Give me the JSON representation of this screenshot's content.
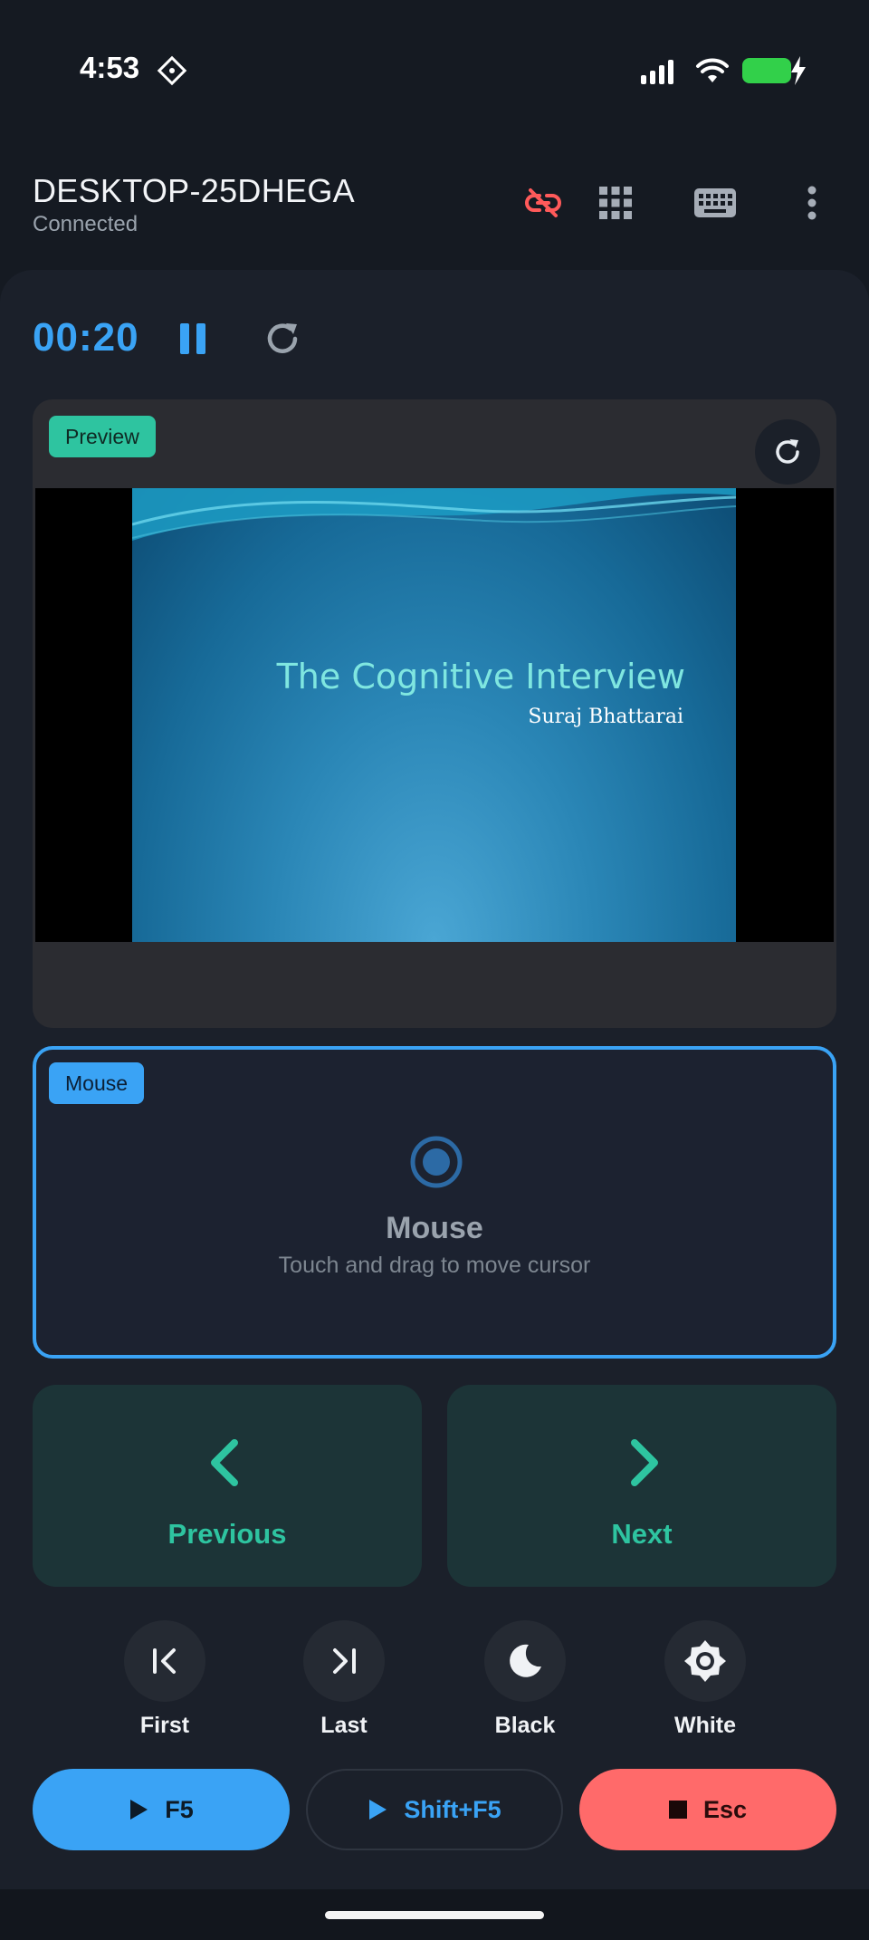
{
  "status_bar": {
    "time": "4:53",
    "icons": [
      "location-diamond-icon",
      "signal-icon",
      "wifi-icon",
      "battery-charging-icon"
    ]
  },
  "header": {
    "device_name": "DESKTOP-25DHEGA",
    "connection_status": "Connected",
    "icons": [
      "disconnect-link-icon",
      "grid-icon",
      "keyboard-icon",
      "more-vert-icon"
    ],
    "disconnect_color": "#ff5a5a"
  },
  "timer": {
    "elapsed": "00:20",
    "controls": [
      "pause-icon",
      "restart-icon"
    ]
  },
  "preview": {
    "badge": "Preview",
    "slide_title": "The Cognitive Interview",
    "slide_subtitle": "Suraj Bhattarai"
  },
  "mouse_pad": {
    "badge": "Mouse",
    "title": "Mouse",
    "hint": "Touch and drag to move cursor"
  },
  "navigation": {
    "previous_label": "Previous",
    "next_label": "Next"
  },
  "slide_controls": [
    {
      "label": "First",
      "icon": "first-slide-icon"
    },
    {
      "label": "Last",
      "icon": "last-slide-icon"
    },
    {
      "label": "Black",
      "icon": "moon-icon"
    },
    {
      "label": "White",
      "icon": "sun-icon"
    }
  ],
  "actions": {
    "start_label": "F5",
    "start_current_label": "Shift+F5",
    "end_label": "Esc"
  },
  "colors": {
    "accent_blue": "#3aa3f5",
    "accent_teal": "#2ec4a0",
    "danger": "#ff6a6a",
    "background": "#151a22"
  }
}
